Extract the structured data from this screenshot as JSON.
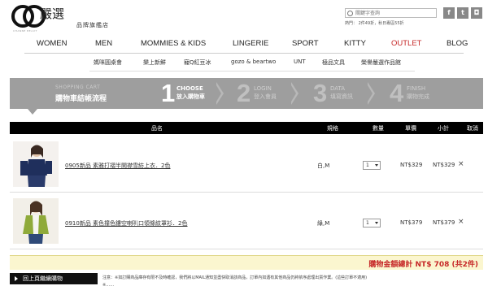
{
  "brand": {
    "logo_letters": "CB",
    "logo_mini": "CHANNE BEAUT",
    "name": "嚴選",
    "sub": "品牌旗艦店"
  },
  "search": {
    "placeholder": "關鍵字查詢",
    "meta": "熱門： 2件49折，秋日專區55折"
  },
  "social": [
    {
      "icon": "facebook-icon",
      "glyph": "f"
    },
    {
      "icon": "twitter-icon",
      "glyph": "t"
    },
    {
      "icon": "instagram-icon",
      "glyph": "◘"
    }
  ],
  "nav": {
    "items": [
      "WOMEN",
      "MEN",
      "MOMMIES & KIDS",
      "LINGERIE",
      "SPORT",
      "KITTY",
      "OUTLET",
      "BLOG"
    ],
    "active_color": "#c62828"
  },
  "subnav": {
    "items": [
      "媽咪圓桌會",
      "樂上新鮮",
      "寵Q紅豆冰",
      "gozo & beartwo",
      "UNT",
      "極品文具",
      "榮譽嚴選作品館"
    ]
  },
  "steps": {
    "caption_en": "SHOPPING CART",
    "caption_zh": "購物車結帳流程",
    "items": [
      {
        "num": "1",
        "en": "CHOOSE",
        "zh": "放入購物車",
        "active": true
      },
      {
        "num": "2",
        "en": "LOGIN",
        "zh": "登入會員",
        "active": false
      },
      {
        "num": "3",
        "en": "DATA",
        "zh": "填寫資訊",
        "active": false
      },
      {
        "num": "4",
        "en": "FINISH",
        "zh": "購物完成",
        "active": false
      }
    ]
  },
  "table": {
    "headers": {
      "name": "品名",
      "spec": "規格",
      "qty": "數量",
      "unit_price": "單價",
      "subtotal": "小計",
      "remove": "取消"
    },
    "rows": [
      {
        "name": "0905新品 素雅打褶半開襟雪紡上衣．2色",
        "spec": "白,M",
        "qty": "1",
        "unit_price": "NT$329",
        "subtotal": "NT$329",
        "remove": "×"
      },
      {
        "name": "0910新品 素色撞色鏤空喇叭口領條紋罩衫．2色",
        "spec": "綠,M",
        "qty": "1",
        "unit_price": "NT$379",
        "subtotal": "NT$379",
        "remove": "×"
      }
    ]
  },
  "total": {
    "label": "購物金額總計 NT$ 708 (共2件)",
    "color": "#c62828"
  },
  "footer": {
    "back_label": "回上頁繼續購物",
    "note_line1": "注意：※如訂購商品庫存有限不及時確認，我們將以MAIL通知並盡快取消該商品，訂單內如遇有其他商品仍將依序處理出貨作業。(這些訂單不適用)",
    "note_line2": "※……"
  }
}
